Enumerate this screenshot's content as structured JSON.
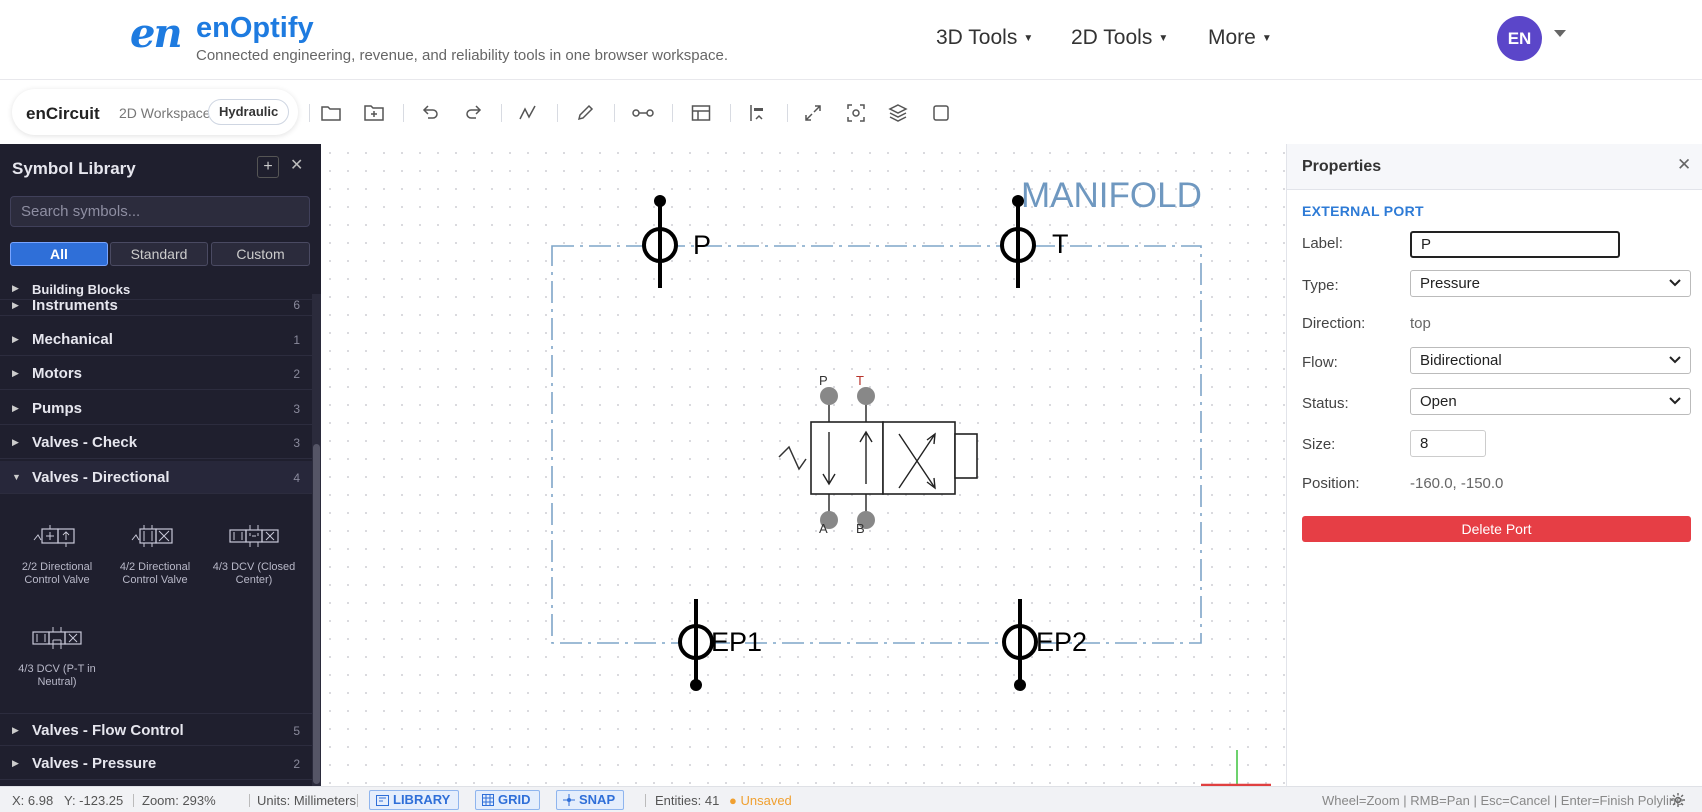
{
  "brand": {
    "logo_mark": "en",
    "name": "enOptify",
    "tagline": "Connected engineering, revenue, and reliability tools in one browser workspace."
  },
  "nav": [
    {
      "label": "3D Tools"
    },
    {
      "label": "2D Tools"
    },
    {
      "label": "More"
    }
  ],
  "user": {
    "initials": "EN"
  },
  "app": {
    "name": "enCircuit",
    "workspace": "2D Workspace",
    "mode": "Hydraulic"
  },
  "toolbar_icons": [
    "folder-open-icon",
    "new-file-icon",
    "undo-icon",
    "redo-icon",
    "polyline-icon",
    "pen-icon",
    "connect-icon",
    "table-icon",
    "align-icon",
    "fit-view-icon",
    "zoom-selection-icon",
    "layers-icon",
    "frame-icon"
  ],
  "sidebar": {
    "title": "Symbol Library",
    "search_placeholder": "Search symbols...",
    "filters": [
      "All",
      "Standard",
      "Custom"
    ],
    "active_filter": "All",
    "categories_top": [
      {
        "name": "Building Blocks",
        "count": ""
      },
      {
        "name": "Instruments",
        "count": "6"
      },
      {
        "name": "Mechanical",
        "count": "1"
      },
      {
        "name": "Motors",
        "count": "2"
      },
      {
        "name": "Pumps",
        "count": "3"
      },
      {
        "name": "Valves - Check",
        "count": "3"
      },
      {
        "name": "Valves - Directional",
        "count": "4"
      }
    ],
    "symbols": [
      {
        "label": "2/2 Directional Control Valve"
      },
      {
        "label": "4/2 Directional Control Valve"
      },
      {
        "label": "4/3 DCV (Closed Center)"
      },
      {
        "label": "4/3 DCV (P-T in Neutral)"
      }
    ],
    "categories_bottom": [
      {
        "name": "Valves - Flow Control",
        "count": "5"
      },
      {
        "name": "Valves - Pressure",
        "count": "2"
      }
    ]
  },
  "canvas": {
    "manifold_label": "MANIFOLD",
    "ports": {
      "p": "P",
      "t": "T",
      "ep1": "EP1",
      "ep2": "EP2"
    },
    "valve_ports": {
      "p": "P",
      "t": "T",
      "a": "A",
      "b": "B"
    }
  },
  "properties": {
    "title": "Properties",
    "section": "EXTERNAL PORT",
    "label_label": "Label:",
    "label_value": "P",
    "type_label": "Type:",
    "type_value": "Pressure",
    "direction_label": "Direction:",
    "direction_value": "top",
    "flow_label": "Flow:",
    "flow_value": "Bidirectional",
    "status_label": "Status:",
    "status_value": "Open",
    "size_label": "Size:",
    "size_value": "8",
    "position_label": "Position:",
    "position_value": "-160.0, -150.0",
    "delete_label": "Delete Port"
  },
  "statusbar": {
    "x": "X: 6.98",
    "y": "Y: -123.25",
    "zoom": "Zoom: 293%",
    "units": "Units: Millimeters",
    "library": "LIBRARY",
    "grid": "GRID",
    "snap": "SNAP",
    "entities": "Entities: 41",
    "unsaved": "Unsaved",
    "hint": "Wheel=Zoom | RMB=Pan | Esc=Cancel | Enter=Finish Polyline"
  },
  "colors": {
    "brand": "#1e7be0",
    "sidebar_bg": "#1f1f2e",
    "filter_active": "#2f6fd8",
    "delete": "#e63e45",
    "avatar": "#5b46c9",
    "manifold": "#6f98c0",
    "unsaved": "#f0a030"
  }
}
